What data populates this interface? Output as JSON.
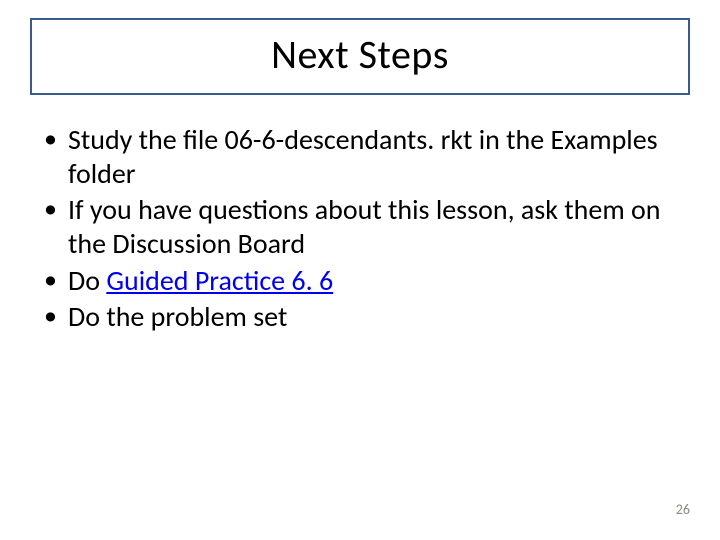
{
  "title": "Next Steps",
  "bullets": [
    {
      "pre": "Study the file 06-6-descendants. rkt in the Examples folder",
      "link": "",
      "post": ""
    },
    {
      "pre": "If you have questions about this lesson, ask them on the Discussion Board",
      "link": "",
      "post": ""
    },
    {
      "pre": "Do ",
      "link": "Guided Practice 6. 6",
      "post": ""
    },
    {
      "pre": "Do the problem set",
      "link": "",
      "post": ""
    }
  ],
  "page_number": "26"
}
